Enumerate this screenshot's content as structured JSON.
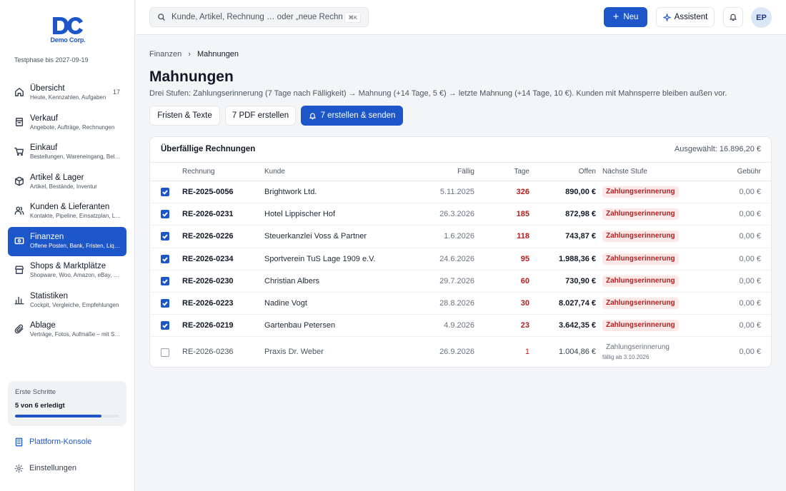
{
  "brand": {
    "logo_text": "Demo Corp.",
    "trial": "Testphase bis 2027-09-19"
  },
  "nav": [
    {
      "title": "Übersicht",
      "sub": "Heute, Kennzahlen, Aufgaben",
      "badge": "17",
      "icon": "home-icon"
    },
    {
      "title": "Verkauf",
      "sub": "Angebote, Aufträge, Rechnungen",
      "icon": "receipt-icon"
    },
    {
      "title": "Einkauf",
      "sub": "Bestellungen, Wareneingang, Belege",
      "icon": "cart-icon"
    },
    {
      "title": "Artikel & Lager",
      "sub": "Artikel, Bestände, Inventur",
      "icon": "box-icon"
    },
    {
      "title": "Kunden & Lieferanten",
      "sub": "Kontakte, Pipeline, Einsatzplan, Leads",
      "icon": "users-icon"
    },
    {
      "title": "Finanzen",
      "sub": "Offene Posten, Bank, Fristen, Liquidität",
      "icon": "wallet-icon",
      "active": true
    },
    {
      "title": "Shops & Marktplätze",
      "sub": "Shopware, Woo, Amazon, eBay, Etsy",
      "icon": "shop-icon"
    },
    {
      "title": "Statistiken",
      "sub": "Cockpit, Vergleiche, Empfehlungen",
      "icon": "chart-icon"
    },
    {
      "title": "Ablage",
      "sub": "Verträge, Fotos, Aufmaße – mit Suche",
      "icon": "paperclip-icon"
    }
  ],
  "steps": {
    "title": "Erste Schritte",
    "count": "5 von 6 erledigt",
    "progress": 0.83
  },
  "side_links": {
    "platform": "Plattform-Konsole",
    "settings": "Einstellungen"
  },
  "topbar": {
    "search_placeholder": "Kunde, Artikel, Rechnung … oder „neue Rechnung“",
    "shortcut": "⌘K",
    "new_label": "Neu",
    "assistant_label": "Assistent",
    "avatar": "EP"
  },
  "breadcrumb": {
    "parent": "Finanzen",
    "separator": "›",
    "current": "Mahnungen"
  },
  "page": {
    "title": "Mahnungen",
    "description": "Drei Stufen: Zahlungserinnerung (7 Tage nach Fälligkeit) → Mahnung (+14 Tage, 5 €) → letzte Mahnung (+14 Tage, 10 €). Kunden mit Mahnsperre bleiben außen vor.",
    "actions": {
      "deadlines": "Fristen & Texte",
      "pdf": "7 PDF erstellen",
      "send": "7 erstellen & senden"
    }
  },
  "table": {
    "title": "Überfällige Rechnungen",
    "selected": "Ausgewählt: 16.896,20 €",
    "headers": {
      "invoice": "Rechnung",
      "customer": "Kunde",
      "due": "Fällig",
      "days": "Tage",
      "open": "Offen",
      "next": "Nächste Stufe",
      "fee": "Gebühr"
    },
    "rows": [
      {
        "checked": true,
        "invoice": "RE-2025-0056",
        "customer": "Brightwork Ltd.",
        "due": "5.11.2025",
        "days": "326",
        "open": "890,00 €",
        "next": "Zahlungserinnerung",
        "fee": "0,00 €"
      },
      {
        "checked": true,
        "invoice": "RE-2026-0231",
        "customer": "Hotel Lippischer Hof",
        "due": "26.3.2026",
        "days": "185",
        "open": "872,98 €",
        "next": "Zahlungserinnerung",
        "fee": "0,00 €"
      },
      {
        "checked": true,
        "invoice": "RE-2026-0226",
        "customer": "Steuerkanzlei Voss & Partner",
        "due": "1.6.2026",
        "days": "118",
        "open": "743,87 €",
        "next": "Zahlungserinnerung",
        "fee": "0,00 €"
      },
      {
        "checked": true,
        "invoice": "RE-2026-0234",
        "customer": "Sportverein TuS Lage 1909 e.V.",
        "due": "24.6.2026",
        "days": "95",
        "open": "1.988,36 €",
        "next": "Zahlungserinnerung",
        "fee": "0,00 €"
      },
      {
        "checked": true,
        "invoice": "RE-2026-0230",
        "customer": "Christian Albers",
        "due": "29.7.2026",
        "days": "60",
        "open": "730,90 €",
        "next": "Zahlungserinnerung",
        "fee": "0,00 €"
      },
      {
        "checked": true,
        "invoice": "RE-2026-0223",
        "customer": "Nadine Vogt",
        "due": "28.8.2026",
        "days": "30",
        "open": "8.027,74 €",
        "next": "Zahlungserinnerung",
        "fee": "0,00 €"
      },
      {
        "checked": true,
        "invoice": "RE-2026-0219",
        "customer": "Gartenbau Petersen",
        "due": "4.9.2026",
        "days": "23",
        "open": "3.642,35 €",
        "next": "Zahlungserinnerung",
        "fee": "0,00 €"
      },
      {
        "checked": false,
        "invoice": "RE-2026-0236",
        "customer": "Praxis Dr. Weber",
        "due": "26.9.2026",
        "days": "1",
        "open": "1.004,86 €",
        "next": "Zahlungserinnerung",
        "next_sub": "fällig ab 3.10.2026",
        "fee": "0,00 €"
      }
    ]
  },
  "colors": {
    "accent": "#1c56c9",
    "danger": "#b91c1c",
    "badge_bg": "#fde8e8"
  }
}
